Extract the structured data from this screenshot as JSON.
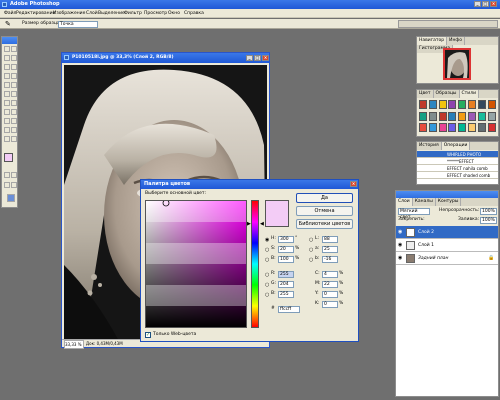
{
  "app": {
    "title": "Adobe Photoshop",
    "menu": [
      "Файл",
      "Редактирование",
      "Изображение",
      "Слой",
      "Выделение",
      "Фильтр",
      "Просмотр",
      "Окно",
      "Справка"
    ]
  },
  "options_bar": {
    "sample_label": "Размер образца:",
    "sample_value": "Точка"
  },
  "document": {
    "title": "P1010518l.jpg @ 33,3% (Слой 2, RGB/8)",
    "zoom": "33,33 %",
    "doc_info": "Док: 0,43М/0,43М"
  },
  "navigator": {
    "tabs": [
      "Навигатор",
      "Инфо",
      "Гистограмма"
    ]
  },
  "swatches": {
    "tabs": [
      "Цвет",
      "Образцы",
      "Стили"
    ],
    "colors": [
      "#c0392b",
      "#2e86c1",
      "#f1c40f",
      "#8e44ad",
      "#27ae60",
      "#e67e22",
      "#34495e",
      "#d35400",
      "#16a085",
      "#7f8c8d",
      "#c0392b",
      "#2980b9",
      "#f39c12",
      "#9b59b6",
      "#1abc9c",
      "#95a5a6",
      "#e74c3c",
      "#3498db",
      "#e84393",
      "#6c5ce7",
      "#00b894",
      "#fdcb6e",
      "#636e72",
      "#d63031"
    ]
  },
  "actions": {
    "tabs": [
      "История",
      "Операции"
    ],
    "items": [
      "WHIRLED PHOTO",
      "******EFFECT",
      "EFFECT nahila comb",
      "EFFECT shaded comb"
    ]
  },
  "color_picker": {
    "title": "Палитра цветов",
    "prompt": "Выберите основной цвет:",
    "ok": "Да",
    "cancel": "Отмена",
    "libraries": "Библиотеки цветов",
    "web_only": "Только Web-цвета",
    "current_color": "#f3ccf6",
    "fields": {
      "H": "300",
      "H_unit": "°",
      "S": "20",
      "S_unit": "%",
      "B": "100",
      "B_unit": "%",
      "R": "255",
      "G": "204",
      "Bv": "255",
      "L": "88",
      "a": "25",
      "b": "-16",
      "C": "4",
      "C_unit": "%",
      "M": "22",
      "M_unit": "%",
      "Y": "0",
      "Y_unit": "%",
      "K": "0",
      "K_unit": "%",
      "hex": "ffccff"
    }
  },
  "layers": {
    "tabs": [
      "Слои",
      "Каналы",
      "Контуры"
    ],
    "blend_mode": "Мягкий свет",
    "opacity_label": "Непрозрачность:",
    "opacity": "100%",
    "lock_label": "Закрепить:",
    "fill_label": "Заливка:",
    "fill": "100%",
    "items": [
      "Слой 2",
      "Слой 1",
      "Задний план"
    ]
  }
}
